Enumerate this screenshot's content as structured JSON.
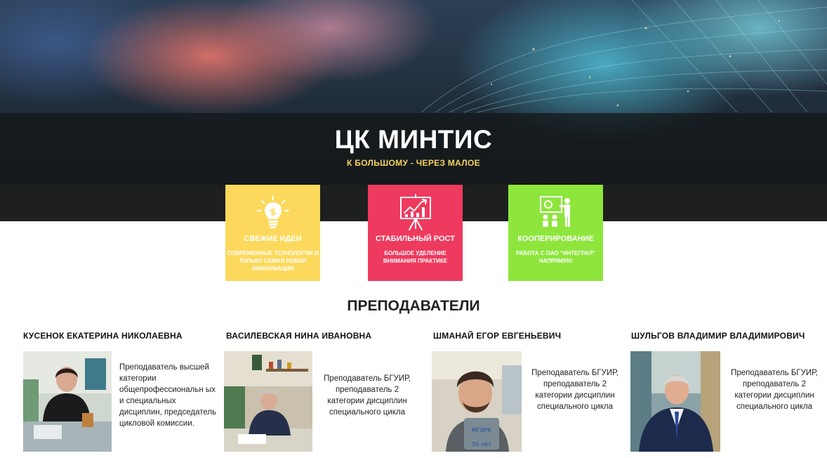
{
  "header": {
    "title": "ЦК МИНТИС",
    "tagline": "К БОЛЬШОМУ - ЧЕРЕЗ МАЛОЕ"
  },
  "features": [
    {
      "title": "СВЕЖИЕ ИДЕИ",
      "description": "СОВРЕМЕННЫЕ ТЕХНОЛОГИИ И ТОЛЬКО САМАЯ НОВАЯ ИНФОРМАЦИЯ",
      "color": "#fcd95c",
      "icon": "lightbulb-dollar-icon"
    },
    {
      "title": "СТАБИЛЬНЫЙ РОСТ",
      "description": "БОЛЬШОЕ УДЕЛЕНИЕ ВНИМАНИЯ ПРАКТИКЕ",
      "color": "#ee3a5e",
      "icon": "growth-chart-icon"
    },
    {
      "title": "КООПЕРИРОВАНИЕ",
      "description": "РАБОТА С ОАО \"ИНТЕГРАЛ\" НАПРЯМУЮ",
      "color": "#8ee63c",
      "icon": "presentation-team-icon"
    }
  ],
  "teachers_section": {
    "title": "ПРЕПОДАВАТЕЛИ"
  },
  "teachers": [
    {
      "name": "КУСЕНОК ЕКАТЕРИНА НИКОЛАЕВНА",
      "description": "Преподаватель высшей категории общепрофессиональн ых и специальных дисциплин, председатель цикловой комиссии."
    },
    {
      "name": "ВАСИЛЕВСКАЯ НИНА ИВАНОВНА",
      "description": "Преподаватель БГУИР, преподаватель 2 категории дисциплин специального цикла"
    },
    {
      "name": "ШМАНАЙ ЕГОР ЕВГЕНЬЕВИЧ",
      "description": "Преподаватель БГУИР, преподаватель 2 категории дисциплин специального цикла"
    },
    {
      "name": "ШУЛЬГОВ ВЛАДИМИР ВЛАДИМИРОВИЧ",
      "description": "Преподаватель БГУИР, преподаватель 2 категории дисциплин специального цикла"
    }
  ]
}
